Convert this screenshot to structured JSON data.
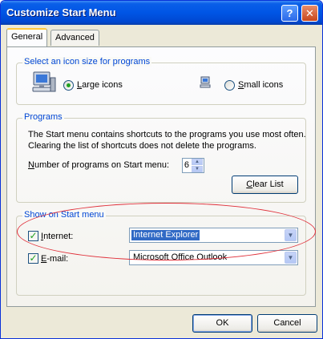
{
  "window": {
    "title": "Customize Start Menu"
  },
  "tabs": [
    {
      "label": "General",
      "selected": true
    },
    {
      "label": "Advanced",
      "selected": false
    }
  ],
  "icon_size": {
    "legend": "Select an icon size for programs",
    "options": [
      {
        "label": "Large icons",
        "mnemonic": "L",
        "rest": "arge icons",
        "selected": true,
        "icon": "large-computer-icon"
      },
      {
        "label": "Small icons",
        "mnemonic": "S",
        "rest": "mall icons",
        "selected": false,
        "icon": "small-computer-icon"
      }
    ]
  },
  "programs": {
    "legend": "Programs",
    "description_line1": "The Start menu contains shortcuts to the programs you use most often.",
    "description_line2": "Clearing the list of shortcuts does not delete the programs.",
    "count_label_mnemonic": "N",
    "count_label_rest": "umber of programs on Start menu:",
    "count_value": "6",
    "clear_button_mnemonic": "C",
    "clear_button_rest": "lear List"
  },
  "show_on_start": {
    "legend": "Show on Start menu",
    "internet": {
      "mnemonic": "I",
      "rest": "nternet:",
      "checked": true,
      "value": "Internet Explorer"
    },
    "email": {
      "mnemonic": "E",
      "rest": "-mail:",
      "checked": true,
      "value": "Microsoft Office Outlook"
    }
  },
  "footer": {
    "ok_label": "OK",
    "cancel_label": "Cancel"
  },
  "colors": {
    "title_blue": "#0055e5",
    "group_label": "#0046d5",
    "annotation_red": "#e0303a"
  }
}
